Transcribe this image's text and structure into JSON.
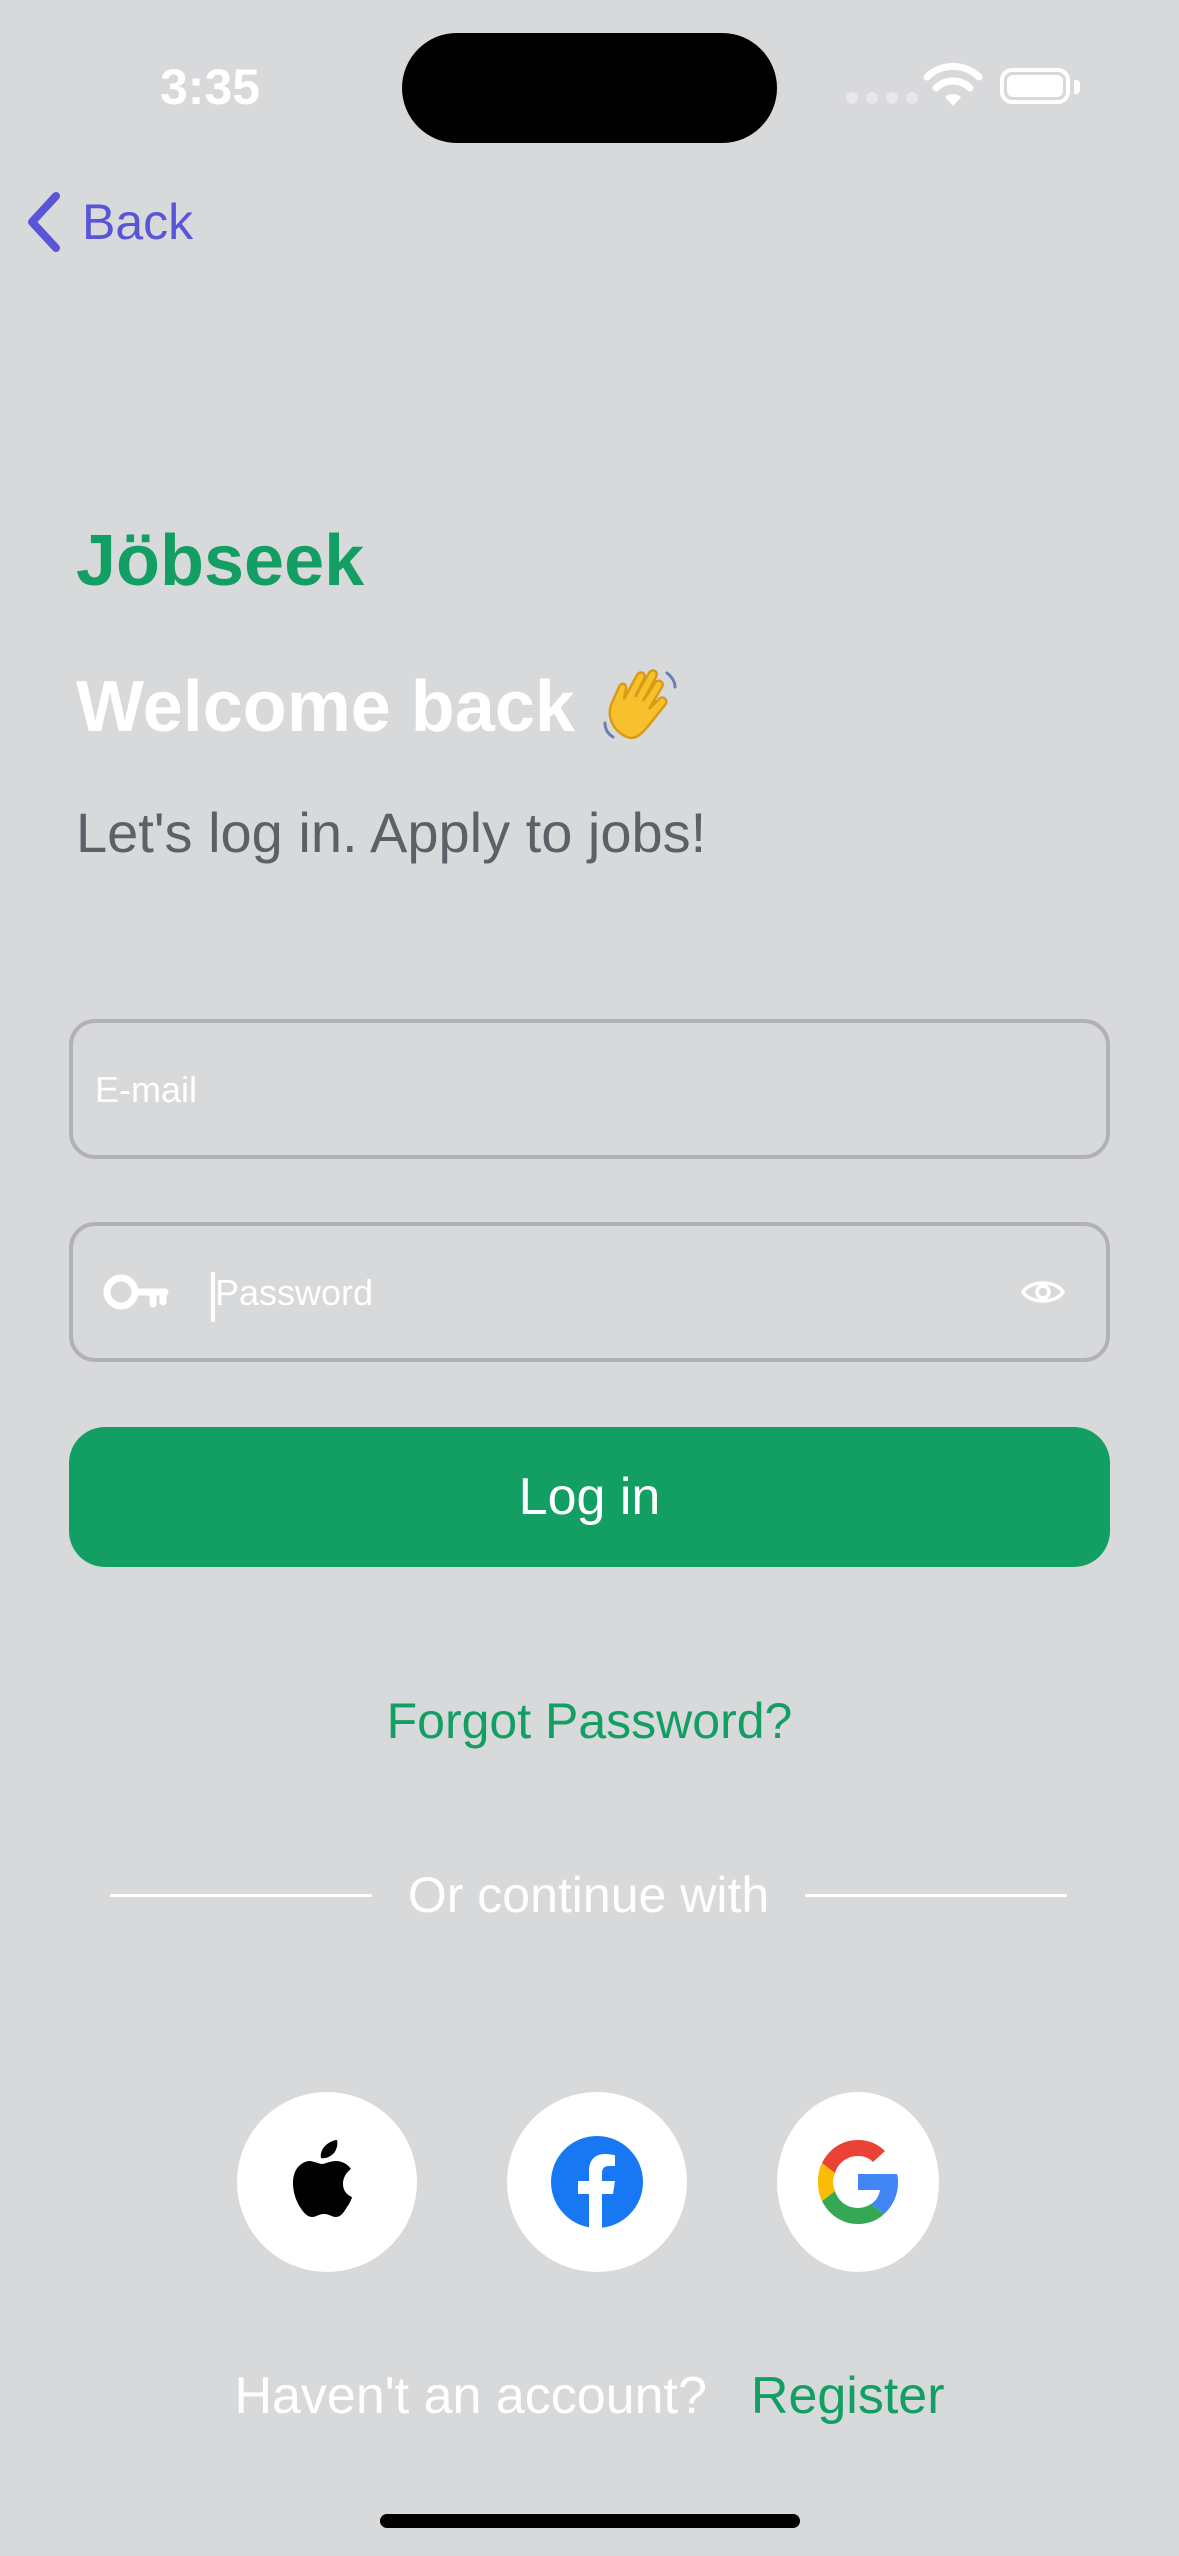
{
  "status_bar": {
    "time": "3:35"
  },
  "nav": {
    "back_label": "Back"
  },
  "header": {
    "brand": "Jöbseek",
    "welcome": "Welcome back",
    "subtitle": "Let's log in. Apply to jobs!"
  },
  "form": {
    "email_placeholder": "E-mail",
    "email_value": "",
    "password_placeholder": "Password",
    "password_value": "",
    "login_label": "Log in",
    "forgot_label": "Forgot Password?"
  },
  "social": {
    "divider_text": "Or continue with",
    "providers": [
      "apple-icon",
      "facebook-icon",
      "google-icon"
    ]
  },
  "footer": {
    "question": "Haven't an account?",
    "register_label": "Register"
  },
  "colors": {
    "background": "#d8d9db",
    "accent": "#139f63",
    "back_link": "#5856d6"
  }
}
